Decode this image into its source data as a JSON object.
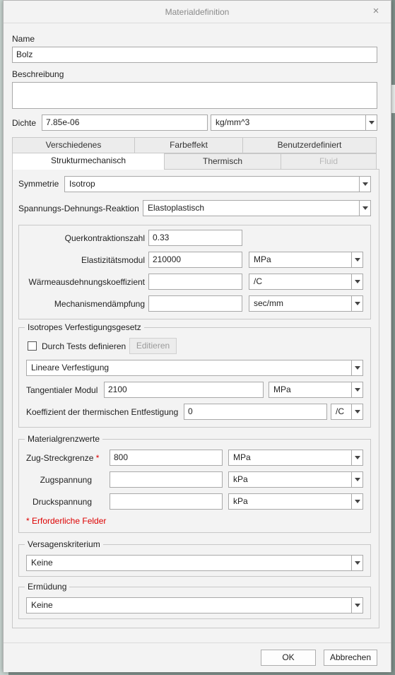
{
  "dialog": {
    "title": "Materialdefinition"
  },
  "name": {
    "label": "Name",
    "value": "Bolz"
  },
  "beschreibung": {
    "label": "Beschreibung",
    "value": ""
  },
  "dichte": {
    "label": "Dichte",
    "value": "7.85e-06",
    "unit": "kg/mm^3"
  },
  "tabs_row1": [
    "Verschiedenes",
    "Farbeffekt",
    "Benutzerdefiniert"
  ],
  "tabs_row2": [
    "Strukturmechanisch",
    "Thermisch",
    "Fluid"
  ],
  "struktur": {
    "symmetrie_label": "Symmetrie",
    "symmetrie_value": "Isotrop",
    "reaktion_label": "Spannungs-Dehnungs-Reaktion",
    "reaktion_value": "Elastoplastisch"
  },
  "props": {
    "querkontraktion_label": "Querkontraktionszahl",
    "querkontraktion_value": "0.33",
    "emodul_label": "Elastizitätsmodul",
    "emodul_value": "210000",
    "emodul_unit": "MPa",
    "waerme_label": "Wärmeausdehnungskoeffizient",
    "waerme_value": "",
    "waerme_unit": "/C",
    "daempfung_label": "Mechanismendämpfung",
    "daempfung_value": "",
    "daempfung_unit": "sec/mm"
  },
  "verfestigung": {
    "title": "Isotropes Verfestigungsgesetz",
    "tests_label": "Durch Tests definieren",
    "editieren_label": "Editieren",
    "typ_value": "Lineare Verfestigung",
    "tangential_label": "Tangentialer Modul",
    "tangential_value": "2100",
    "tangential_unit": "MPa",
    "koeff_label": "Koeffizient der thermischen Entfestigung",
    "koeff_value": "0",
    "koeff_unit": "/C"
  },
  "grenzwerte": {
    "title": "Materialgrenzwerte",
    "zug_streck_label": "Zug-Streckgrenze",
    "required_mark": "*",
    "zug_streck_value": "800",
    "zug_streck_unit": "MPa",
    "zug_label": "Zugspannung",
    "zug_value": "",
    "zug_unit": "kPa",
    "druck_label": "Druckspannung",
    "druck_value": "",
    "druck_unit": "kPa",
    "required_note": "* Erforderliche Felder"
  },
  "versagen": {
    "title": "Versagenskriterium",
    "value": "Keine"
  },
  "ermuedung": {
    "title": "Ermüdung",
    "value": "Keine"
  },
  "footer": {
    "ok_label": "OK",
    "cancel_label": "Abbrechen"
  }
}
